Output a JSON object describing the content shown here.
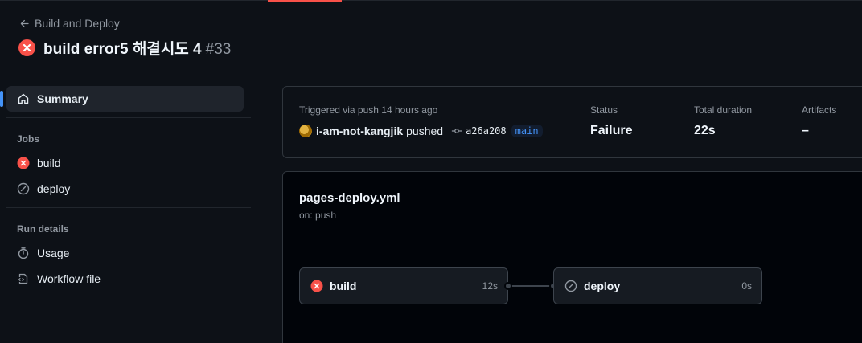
{
  "colors": {
    "accent": "#4493f8",
    "failure": "#f85149",
    "top_accent": "#f85149"
  },
  "nav": {
    "back_label": "Build and Deploy"
  },
  "run": {
    "title": "build error5 해결시도 4",
    "number": "#33",
    "status_icon": "x-circle-fill-icon"
  },
  "sidebar": {
    "summary_label": "Summary",
    "jobs_heading": "Jobs",
    "jobs": [
      {
        "label": "build",
        "icon": "x-circle-fill-icon"
      },
      {
        "label": "deploy",
        "icon": "skip-icon"
      }
    ],
    "run_details_heading": "Run details",
    "details": [
      {
        "label": "Usage",
        "icon": "stopwatch-icon"
      },
      {
        "label": "Workflow file",
        "icon": "file-code-icon"
      }
    ]
  },
  "summary": {
    "trigger_label": "Triggered via push 14 hours ago",
    "actor": "i-am-not-kangjik",
    "action": "pushed",
    "commit": "a26a208",
    "branch": "main",
    "status_label": "Status",
    "status_value": "Failure",
    "duration_label": "Total duration",
    "duration_value": "22s",
    "artifacts_label": "Artifacts",
    "artifacts_value": "–"
  },
  "workflow": {
    "file": "pages-deploy.yml",
    "trigger": "on: push",
    "jobs": [
      {
        "name": "build",
        "duration": "12s",
        "icon": "x-circle-fill-icon"
      },
      {
        "name": "deploy",
        "duration": "0s",
        "icon": "skip-icon"
      }
    ]
  }
}
